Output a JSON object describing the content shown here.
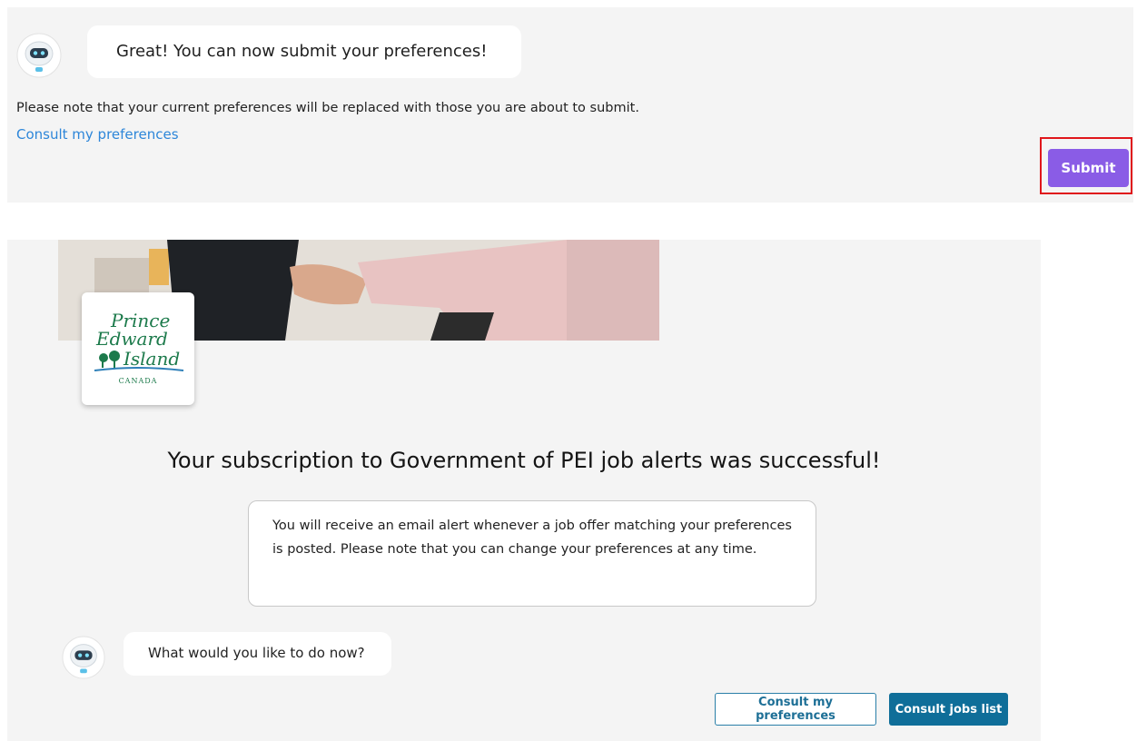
{
  "top_panel": {
    "bot_message": "Great! You can now submit your preferences!",
    "note": "Please note that your current preferences will be replaced with those you are about to submit.",
    "consult_link": "Consult my preferences",
    "submit_label": "Submit"
  },
  "bottom_panel": {
    "logo": {
      "line1": "Prince",
      "line2": "Edward",
      "line3": "Island",
      "country": "CANADA"
    },
    "heading": "Your subscription to Government of PEI job alerts was successful!",
    "info": "You will receive an email alert whenever a job offer matching your preferences is posted. Please note that you can change your preferences at any time.",
    "bot_question": "What would you like to do now?",
    "consult_prefs_button": "Consult my preferences",
    "consult_jobs_button": "Consult jobs list"
  },
  "colors": {
    "accent_purple": "#8a5ce6",
    "highlight_red": "#e0161b",
    "link_blue": "#2d86d9",
    "primary_teal": "#0f6e99",
    "logo_green": "#1c7a4b"
  },
  "icons": [
    "chatbot-avatar-icon",
    "pei-logo"
  ]
}
